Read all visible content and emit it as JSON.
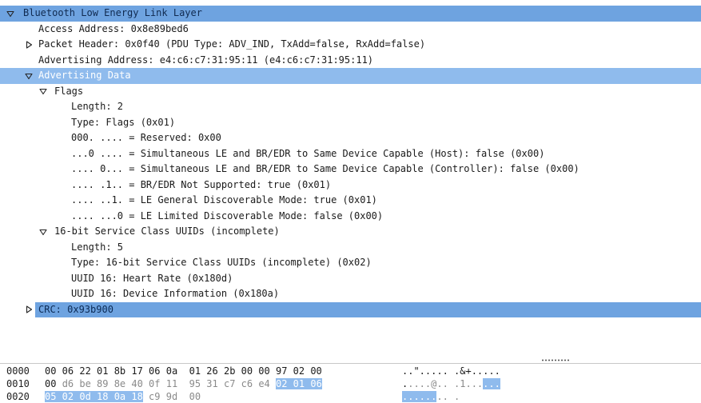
{
  "tree": {
    "rows": [
      {
        "id": "btle",
        "level": 0,
        "toggle": "expanded",
        "text": "Bluetooth Low Energy Link Layer",
        "state": "selected"
      },
      {
        "id": "access-address",
        "level": 1,
        "toggle": "none",
        "text": "Access Address: 0x8e89bed6",
        "state": "normal"
      },
      {
        "id": "packet-header",
        "level": 1,
        "toggle": "collapsed",
        "text": "Packet Header: 0x0f40 (PDU Type: ADV_IND, TxAdd=false, RxAdd=false)",
        "state": "normal"
      },
      {
        "id": "advertising-address",
        "level": 1,
        "toggle": "none",
        "text": "Advertising Address: e4:c6:c7:31:95:11 (e4:c6:c7:31:95:11)",
        "state": "normal"
      },
      {
        "id": "advertising-data",
        "level": 1,
        "toggle": "expanded",
        "text": "Advertising Data",
        "state": "related"
      },
      {
        "id": "flags",
        "level": 2,
        "toggle": "expanded",
        "text": "Flags",
        "state": "normal"
      },
      {
        "id": "flags-length",
        "level": 3,
        "toggle": "none",
        "text": "Length: 2",
        "state": "normal"
      },
      {
        "id": "flags-type",
        "level": 3,
        "toggle": "none",
        "text": "Type: Flags (0x01)",
        "state": "normal"
      },
      {
        "id": "flags-reserved",
        "level": 3,
        "toggle": "none",
        "text": "000. .... = Reserved: 0x00",
        "state": "normal"
      },
      {
        "id": "flags-sim-host",
        "level": 3,
        "toggle": "none",
        "text": "...0 .... = Simultaneous LE and BR/EDR to Same Device Capable (Host): false (0x00)",
        "state": "normal"
      },
      {
        "id": "flags-sim-controller",
        "level": 3,
        "toggle": "none",
        "text": ".... 0... = Simultaneous LE and BR/EDR to Same Device Capable (Controller): false (0x00)",
        "state": "normal"
      },
      {
        "id": "flags-bredr",
        "level": 3,
        "toggle": "none",
        "text": ".... .1.. = BR/EDR Not Supported: true (0x01)",
        "state": "normal"
      },
      {
        "id": "flags-general",
        "level": 3,
        "toggle": "none",
        "text": ".... ..1. = LE General Discoverable Mode: true (0x01)",
        "state": "normal"
      },
      {
        "id": "flags-limited",
        "level": 3,
        "toggle": "none",
        "text": ".... ...0 = LE Limited Discoverable Mode: false (0x00)",
        "state": "normal"
      },
      {
        "id": "uuids16",
        "level": 2,
        "toggle": "expanded",
        "text": "16-bit Service Class UUIDs (incomplete)",
        "state": "normal"
      },
      {
        "id": "uuids16-length",
        "level": 3,
        "toggle": "none",
        "text": "Length: 5",
        "state": "normal"
      },
      {
        "id": "uuids16-type",
        "level": 3,
        "toggle": "none",
        "text": "Type: 16-bit Service Class UUIDs (incomplete) (0x02)",
        "state": "normal"
      },
      {
        "id": "uuid-heart-rate",
        "level": 3,
        "toggle": "none",
        "text": "UUID 16: Heart Rate (0x180d)",
        "state": "normal"
      },
      {
        "id": "uuid-device-info",
        "level": 3,
        "toggle": "none",
        "text": "UUID 16: Device Information (0x180a)",
        "state": "normal"
      },
      {
        "id": "crc",
        "level": 1,
        "toggle": "collapsed",
        "text": "CRC: 0x93b900",
        "state": "crc"
      }
    ]
  },
  "hex": {
    "rows": [
      {
        "offset": "0000",
        "bytes": [
          {
            "t": "00 06 22 01 8b 17 06 0a  01 26 2b 00 00 97 02 00",
            "s": "normal"
          }
        ],
        "ascii": [
          {
            "t": "..\"..... .&+.....",
            "s": "normal"
          }
        ]
      },
      {
        "offset": "0010",
        "bytes": [
          {
            "t": "00 ",
            "s": "normal"
          },
          {
            "t": "d6 be 89 8e 40 0f 11  95 31 c7 c6 e4 ",
            "s": "dim"
          },
          {
            "t": "02 01 06",
            "s": "hl"
          }
        ],
        "ascii": [
          {
            "t": ".",
            "s": "normal"
          },
          {
            "t": "....@.. .1...",
            "s": "dim"
          },
          {
            "t": "...",
            "s": "hl"
          }
        ]
      },
      {
        "offset": "0020",
        "bytes": [
          {
            "t": "05 02 0d 18 0a 18",
            "s": "hl"
          },
          {
            "t": " c9 9d  00",
            "s": "dim"
          }
        ],
        "ascii": [
          {
            "t": "......",
            "s": "hl"
          },
          {
            "t": ".. .",
            "s": "dim"
          }
        ]
      }
    ]
  }
}
